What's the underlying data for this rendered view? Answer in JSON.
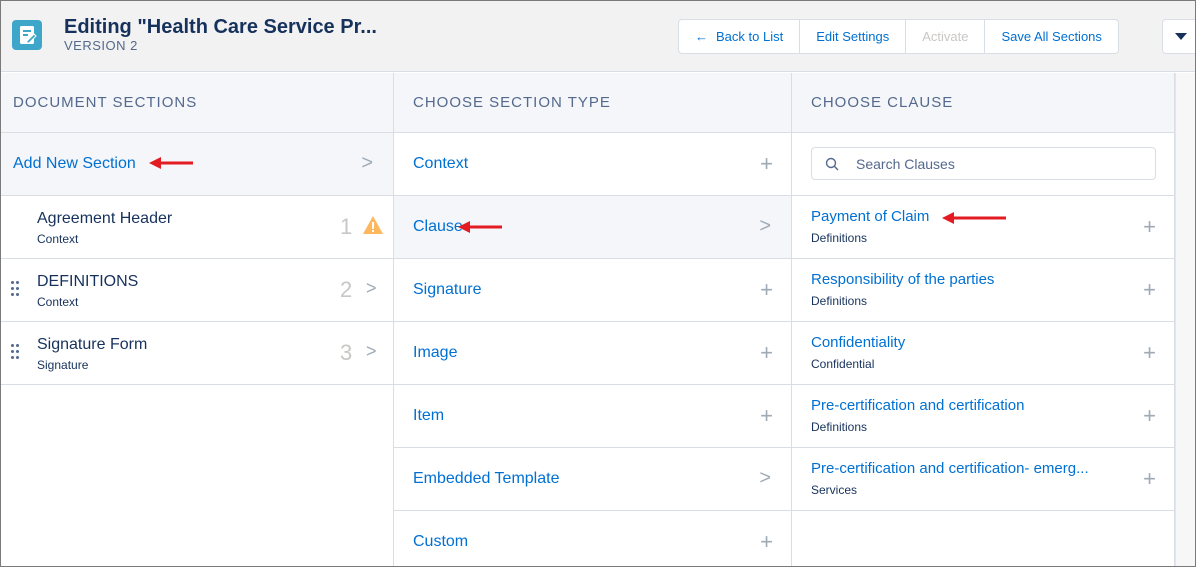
{
  "header": {
    "title": "Editing \"Health Care Service Pr...",
    "subtitle": "VERSION 2",
    "buttons": {
      "back": "Back to List",
      "edit_settings": "Edit Settings",
      "activate": "Activate",
      "save_all": "Save All Sections"
    }
  },
  "document_sections": {
    "heading": "DOCUMENT SECTIONS",
    "add_new": "Add New Section",
    "items": [
      {
        "title": "Agreement Header",
        "type": "Context",
        "number": "1"
      },
      {
        "title": "DEFINITIONS",
        "type": "Context",
        "number": "2"
      },
      {
        "title": "Signature Form",
        "type": "Signature",
        "number": "3"
      }
    ]
  },
  "section_types": {
    "heading": "CHOOSE SECTION TYPE",
    "items": [
      {
        "label": "Context"
      },
      {
        "label": "Clause"
      },
      {
        "label": "Signature"
      },
      {
        "label": "Image"
      },
      {
        "label": "Item"
      },
      {
        "label": "Embedded Template"
      },
      {
        "label": "Custom"
      }
    ]
  },
  "clauses": {
    "heading": "CHOOSE CLAUSE",
    "search_placeholder": "Search Clauses",
    "items": [
      {
        "title": "Payment of Claim",
        "category": "Definitions"
      },
      {
        "title": "Responsibility of the parties",
        "category": "Definitions"
      },
      {
        "title": "Confidentiality",
        "category": "Confidential"
      },
      {
        "title": "Pre-certification and certification",
        "category": "Definitions"
      },
      {
        "title": "Pre-certification and certification- emerg...",
        "category": "Services"
      }
    ]
  },
  "colors": {
    "link": "#0070d2",
    "text": "#16325c",
    "warning": "#ffb75d",
    "annotation_arrow": "#e31b23",
    "app_icon": "#3ea6c9"
  }
}
